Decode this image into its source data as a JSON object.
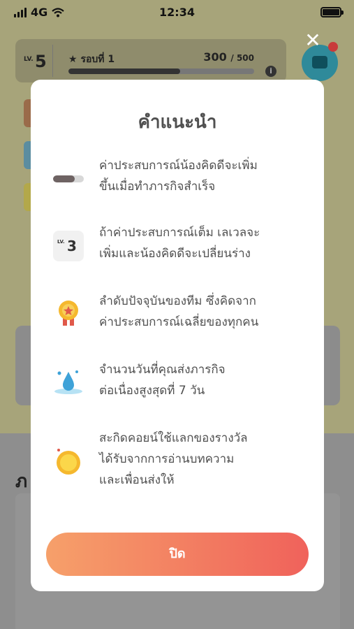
{
  "status_bar": {
    "network": "4G",
    "time": "12:34"
  },
  "background": {
    "level": {
      "label": "LV.",
      "value": "5"
    },
    "round": "รอบที่ 1",
    "exp": {
      "current": "300",
      "max": "500",
      "progress": 0.6
    },
    "section_heading": "ภ"
  },
  "modal": {
    "title": "คำแนะนำ",
    "items": [
      {
        "icon": "exp-bar-icon",
        "text_line1": "ค่าประสบการณ์น้องคิดดีจะเพิ่ม",
        "text_line2": "ขึ้นเมื่อทำภารกิจสำเร็จ"
      },
      {
        "icon": "level-badge-icon",
        "icon_small": "LV.",
        "icon_num": "3",
        "text_line1": "ถ้าค่าประสบการณ์เต็ม เลเวลจะ",
        "text_line2": "เพิ่มและน้องคิดดีจะเปลี่ยนร่าง"
      },
      {
        "icon": "medal-icon",
        "text_line1": "ลำดับปัจจุบันของทีม ซึ่งคิดจาก",
        "text_line2": "ค่าประสบการณ์เฉลี่ยของทุกคน"
      },
      {
        "icon": "water-drop-icon",
        "text_line1": "จำนวนวันที่คุณส่งภารกิจ",
        "text_line2": "ต่อเนื่องสูงสุดที่ 7 วัน"
      },
      {
        "icon": "coin-icon",
        "text_line1": "สะกิดคอยน์ใช้แลกของรางวัล",
        "text_line2": "ได้รับจากการอ่านบทความ",
        "text_line3": "และเพื่อนส่งให้"
      }
    ],
    "close_button": "ปิด"
  },
  "colors": {
    "button_start": "#f6a06a",
    "button_end": "#f0625b",
    "text": "#505050",
    "overlay_bg": "#a7a47a"
  }
}
